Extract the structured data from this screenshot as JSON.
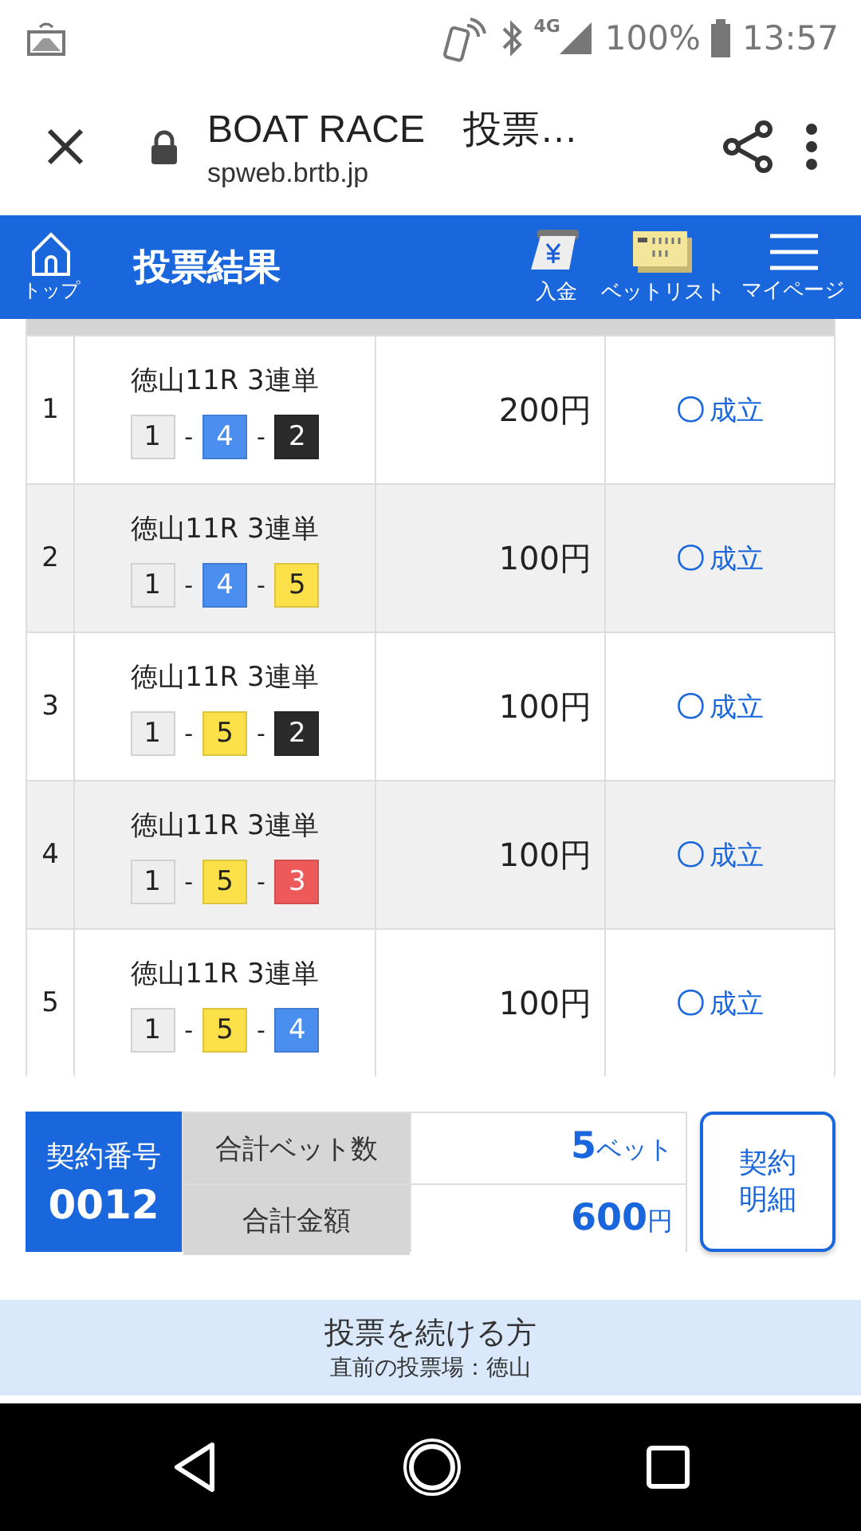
{
  "status_bar": {
    "network": "4G",
    "battery": "100%",
    "time": "13:57"
  },
  "browser": {
    "title": "BOAT RACE　投票…",
    "url": "spweb.brtb.jp"
  },
  "header": {
    "home_label": "トップ",
    "title": "投票結果",
    "actions": [
      {
        "label": "入金",
        "kind": "deposit"
      },
      {
        "label": "ベットリスト",
        "kind": "betlist"
      },
      {
        "label": "マイページ",
        "kind": "menu"
      }
    ]
  },
  "bets": [
    {
      "no": "1",
      "race": "徳山11R 3連単",
      "lanes": [
        {
          "number": "1",
          "color": "#eeeeee"
        },
        {
          "number": "4",
          "color": "#4a8ef0"
        },
        {
          "number": "2",
          "color": "#2b2b2b"
        }
      ],
      "amount": "200円",
      "result_mark": "〇",
      "result": "成立"
    },
    {
      "no": "2",
      "race": "徳山11R 3連単",
      "lanes": [
        {
          "number": "1",
          "color": "#eeeeee"
        },
        {
          "number": "4",
          "color": "#4a8ef0"
        },
        {
          "number": "5",
          "color": "#fbe04a"
        }
      ],
      "amount": "100円",
      "result_mark": "〇",
      "result": "成立"
    },
    {
      "no": "3",
      "race": "徳山11R 3連単",
      "lanes": [
        {
          "number": "1",
          "color": "#eeeeee"
        },
        {
          "number": "5",
          "color": "#fbe04a"
        },
        {
          "number": "2",
          "color": "#2b2b2b"
        }
      ],
      "amount": "100円",
      "result_mark": "〇",
      "result": "成立"
    },
    {
      "no": "4",
      "race": "徳山11R 3連単",
      "lanes": [
        {
          "number": "1",
          "color": "#eeeeee"
        },
        {
          "number": "5",
          "color": "#fbe04a"
        },
        {
          "number": "3",
          "color": "#ee5a5a"
        }
      ],
      "amount": "100円",
      "result_mark": "〇",
      "result": "成立"
    },
    {
      "no": "5",
      "race": "徳山11R 3連単",
      "lanes": [
        {
          "number": "1",
          "color": "#eeeeee"
        },
        {
          "number": "5",
          "color": "#fbe04a"
        },
        {
          "number": "4",
          "color": "#4a8ef0"
        }
      ],
      "amount": "100円",
      "result_mark": "〇",
      "result": "成立"
    }
  ],
  "lane_separator": "-",
  "summary": {
    "contract_label": "契約番号",
    "contract_no": "0012",
    "count_label": "合計ベット数",
    "count_value": "5",
    "count_unit": "ベット",
    "total_label": "合計金額",
    "total_value": "600",
    "total_unit": "円",
    "detail_button": "契約明細"
  },
  "continue_panel": {
    "title": "投票を続ける方",
    "subtitle": "直前の投票場：徳山"
  }
}
